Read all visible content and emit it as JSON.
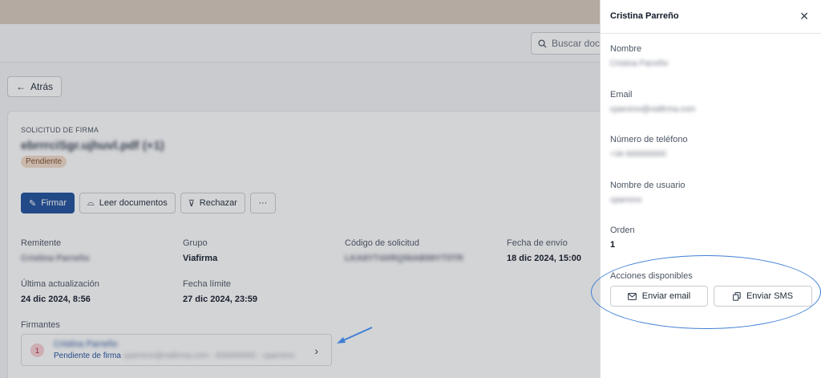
{
  "header": {
    "search_placeholder": "Buscar docu"
  },
  "nav": {
    "back_label": "Atrás"
  },
  "request": {
    "eyebrow": "SOLICITUD DE FIRMA",
    "title": "ebrrrciSgr.ujhuvl.pdf (+1)",
    "status": "Pendiente"
  },
  "actions": {
    "sign": "Firmar",
    "read": "Leer documentos",
    "reject": "Rechazar",
    "more": "···"
  },
  "details": {
    "sender_label": "Remitente",
    "sender_value": "Cristina Parreño",
    "group_label": "Grupo",
    "group_value": "Viafirma",
    "code_label": "Código de solicitud",
    "code_value": "LKA8YT4XRQ56AB99YT5TR",
    "sent_label": "Fecha de envío",
    "sent_value": "18 dic 2024, 15:00",
    "updated_label": "Última actualización",
    "updated_value": "24 dic 2024, 8:56",
    "deadline_label": "Fecha límite",
    "deadline_value": "27 dic 2024, 23:59",
    "signers_label": "Firmantes"
  },
  "signer": {
    "order": "1",
    "name": "Cristina Parreño",
    "status": "Pendiente de firma",
    "extra": "cparreno@viafirma.com · 600000000 · cparreno"
  },
  "panel": {
    "title": "Cristina Parreño",
    "name_label": "Nombre",
    "name_value": "Cristina Parreño",
    "email_label": "Email",
    "email_value": "cparreno@viafirma.com",
    "phone_label": "Número de teléfono",
    "phone_value": "+34 600000000",
    "user_label": "Nombre de usuario",
    "user_value": "cparreno",
    "order_label": "Orden",
    "order_value": "1",
    "actions_label": "Acciones disponibles",
    "email_button": "Enviar email",
    "sms_button": "Enviar SMS"
  },
  "colors": {
    "primary": "#1e4f9c",
    "annotation": "#3f7fd4",
    "badge_bg": "#f3dcc8"
  }
}
